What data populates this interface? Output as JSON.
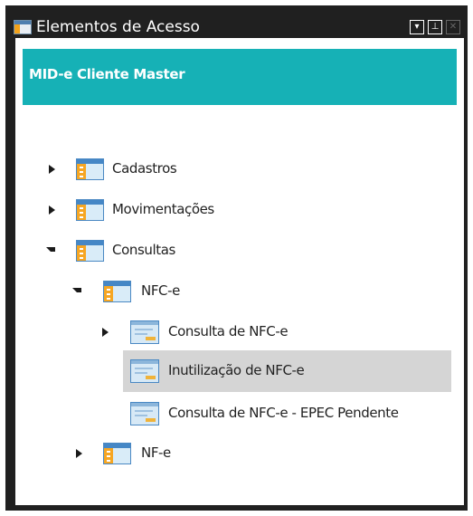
{
  "window": {
    "title": "Elementos de Acesso",
    "buttons": [
      "dropdown-icon",
      "pin-icon",
      "close-icon"
    ]
  },
  "header": {
    "title": "MID-e Cliente Master"
  },
  "tree": {
    "cadastros": "Cadastros",
    "movimentacoes": "Movimentações",
    "consultas": "Consultas",
    "nfce": "NFC-e",
    "consulta_nfce": "Consulta de NFC-e",
    "inutilizacao_nfce": "Inutilização de NFC-e",
    "consulta_epec": "Consulta de NFC-e - EPEC Pendente",
    "nfe": "NF-e"
  },
  "colors": {
    "header": "#16b1b6",
    "selection": "#d5d5d5",
    "frame": "#202020"
  }
}
